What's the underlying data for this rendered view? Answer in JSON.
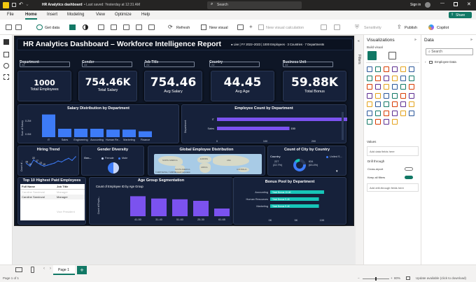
{
  "titlebar": {
    "doc_title": "HR Analytics dashboard",
    "saved": "Last saved: Yesterday at 12:31 AM",
    "search": "Search",
    "signin": "Sign in"
  },
  "menubar": {
    "tabs": [
      "File",
      "Home",
      "Insert",
      "Modeling",
      "View",
      "Optimize",
      "Help"
    ],
    "share": "Share"
  },
  "ribbon": {
    "get_data": "Get data",
    "refresh": "Refresh",
    "new_visual": "New visual",
    "new_calc": "New visual calculation",
    "sensitivity": "Sensitivity",
    "publish": "Publish",
    "copilot": "Copilot"
  },
  "report": {
    "title": "HR Analytics Dashboard – Workforce Intelligence Report",
    "subtitle": "● Live | FY 2022–2023 | 1000 Employees · 3 Countries · 7 Departments",
    "slicers": [
      {
        "label": "Department",
        "value": "All"
      },
      {
        "label": "Gender",
        "value": "All"
      },
      {
        "label": "Job Title",
        "value": "All"
      },
      {
        "label": "Country",
        "value": "All"
      },
      {
        "label": "Business Unit",
        "value": "All"
      }
    ],
    "kpis": [
      {
        "value": "1000",
        "label": "Total Employees"
      },
      {
        "value": "754.46K",
        "label": "Total Salary"
      },
      {
        "value": "754.46",
        "label": "Avg Salary"
      },
      {
        "value": "44.45",
        "label": "Avg Age"
      },
      {
        "value": "59.88K",
        "label": "Total Bonus"
      }
    ],
    "salary_title": "Salary Distribution by Department",
    "salary_ylabel": "Sum of Salary",
    "salary_yticks": [
      "0.2M",
      "0.0M"
    ],
    "headcount_title": "Employee Count by Department",
    "headcount_ylabel": "Department",
    "headcount_xticks": [
      "0",
      "100",
      "200"
    ],
    "hiring_title": "Hiring Trend",
    "hiring_ylabel": "Count of ...",
    "hiring_labels": [
      "15",
      "10",
      "22",
      "17",
      "13",
      "10"
    ],
    "gender_title": "Gender Diversity",
    "gender_legend_label": "Gen...",
    "gender_legend": [
      "Female",
      "Male"
    ],
    "map_title": "Global Employee Distribution",
    "map_labels": [
      "NORTH AMERICA",
      "EUROPE",
      "ASIA",
      "AFRICA",
      "SOUTH AMERICA",
      "AUSTRALIA"
    ],
    "map_attrib": "© 2025 TomTom, © 2025 Microsoft Corporation",
    "city_title": "Count of City by Country",
    "city_legend_label": "Country",
    "city_left_value": "227",
    "city_left_pct": "(22.7%)",
    "city_right_value": "634",
    "city_right_pct": "(63.4%)",
    "city_right_country": "United S...",
    "top10_title": "Top 10 Highest Paid Employees",
    "top10_cols": [
      "Full Name",
      "Job Title"
    ],
    "top10_rows": [
      [
        "Caroline Sandoval",
        "Manager"
      ],
      [
        "Caroline Sandoval",
        "Manager"
      ],
      [
        "",
        "Vice President"
      ]
    ],
    "age_title": "Age Group Segmentation",
    "age_subtitle": "Count of Employee ID by Age Group",
    "age_ylabel": "Count of Emplo...",
    "bonus_title": "Bonus Pool by Department",
    "bonus_xticks": [
      "0K",
      "5K",
      "10K"
    ]
  },
  "chart_data": [
    {
      "type": "bar",
      "title": "Salary Distribution by Department",
      "ylabel": "Sum of Salary",
      "categories": [
        "IT",
        "Sales",
        "Engineering",
        "Accounting",
        "Human Re...",
        "Marketing",
        "Finance"
      ],
      "values": [
        0.27,
        0.1,
        0.1,
        0.1,
        0.09,
        0.09,
        0.07
      ],
      "ylim": [
        0,
        0.3
      ],
      "color": "#3d7bf7"
    },
    {
      "type": "bar",
      "orientation": "horizontal",
      "title": "Employee Count by Department",
      "ylabel": "Department",
      "categories": [
        "IT",
        "Sales"
      ],
      "values": [
        277,
        150
      ],
      "xlim": [
        0,
        290
      ],
      "color": "#7b52ef"
    },
    {
      "type": "line",
      "title": "Hiring Trend",
      "values": [
        15,
        10,
        22,
        17,
        13,
        10,
        12,
        14,
        16,
        20,
        18,
        22,
        25,
        21,
        28
      ],
      "color": "#3d7bf7"
    },
    {
      "type": "pie",
      "title": "Gender Diversity",
      "categories": [
        "Female",
        "Male"
      ],
      "values": [
        50,
        50
      ],
      "colors": [
        "#c8d6f8",
        "#3d7bf7"
      ]
    },
    {
      "type": "pie",
      "title": "Count of City by Country",
      "categories": [
        "",
        "United S..."
      ],
      "values": [
        227,
        634,
        139
      ],
      "colors": [
        "#2c3a57",
        "#3d7bf7",
        "#17c5b8"
      ]
    },
    {
      "type": "bar",
      "title": "Age Group Segmentation",
      "categories": [
        "41-50",
        "31-40",
        "51-60",
        "25-30",
        "61-65"
      ],
      "values": [
        260,
        230,
        220,
        200,
        100
      ],
      "ylim": [
        0,
        300
      ],
      "color": "#7b52ef"
    },
    {
      "type": "bar",
      "orientation": "horizontal",
      "title": "Bonus Pool by Department",
      "categories": [
        "Accounting",
        "Human Resources",
        "Marketing"
      ],
      "values": [
        10.4,
        9.4,
        9.4
      ],
      "labels": [
        "Total Bonus 10.4K",
        "Total Bonus 9.4K",
        "Total Bonus 9.4K"
      ],
      "xlim": [
        0,
        10.7
      ],
      "color": "#17c5b8"
    }
  ],
  "vizpane": {
    "title": "Visualizations",
    "build": "Build visual",
    "values": "Values",
    "values_ph": "Add data fields here",
    "drill": "Drill through",
    "cross": "Cross-report",
    "keep": "Keep all filters",
    "drill_ph": "Add drill-through fields here",
    "filters": "Filters"
  },
  "datapane": {
    "title": "Data",
    "search": "Search",
    "table": "Employee Data"
  },
  "tabbar": {
    "page": "Page 1"
  },
  "statusbar": {
    "page": "Page 1 of 1",
    "zoom": "80%",
    "update": "Update available (click to download)"
  }
}
